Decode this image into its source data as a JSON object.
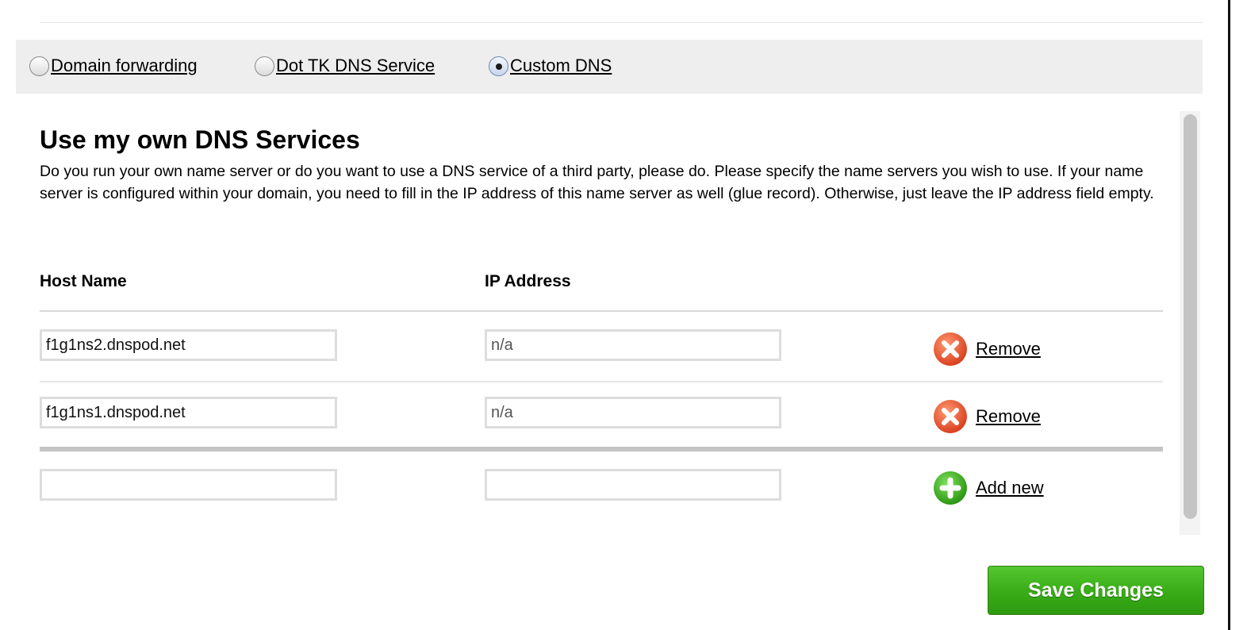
{
  "dns_options": [
    {
      "label": "Domain forwarding",
      "checked": false
    },
    {
      "label": "Dot TK DNS Service",
      "checked": false
    },
    {
      "label": "Custom DNS",
      "checked": true
    }
  ],
  "section": {
    "title": "Use my own DNS Services",
    "description": "Do you run your own name server or do you want to use a DNS service of a third party, please do. Please specify the name servers you wish to use. If your name server is configured within your domain, you need to fill in the IP address of this name server as well (glue record). Otherwise, just leave the IP address field empty."
  },
  "table": {
    "headers": {
      "host": "Host Name",
      "ip": "IP Address"
    },
    "rows": [
      {
        "host": "f1g1ns2.dnspod.net",
        "ip": "n/a",
        "action": "Remove"
      },
      {
        "host": "f1g1ns1.dnspod.net",
        "ip": "n/a",
        "action": "Remove"
      }
    ],
    "new_row": {
      "host": "",
      "ip": "",
      "action": "Add new"
    }
  },
  "save_button": "Save Changes",
  "icons": {
    "remove": "remove-x-icon",
    "add": "add-plus-icon"
  },
  "colors": {
    "remove": "#e8532f",
    "add": "#3aa81e",
    "save_button": "#3aad19"
  }
}
